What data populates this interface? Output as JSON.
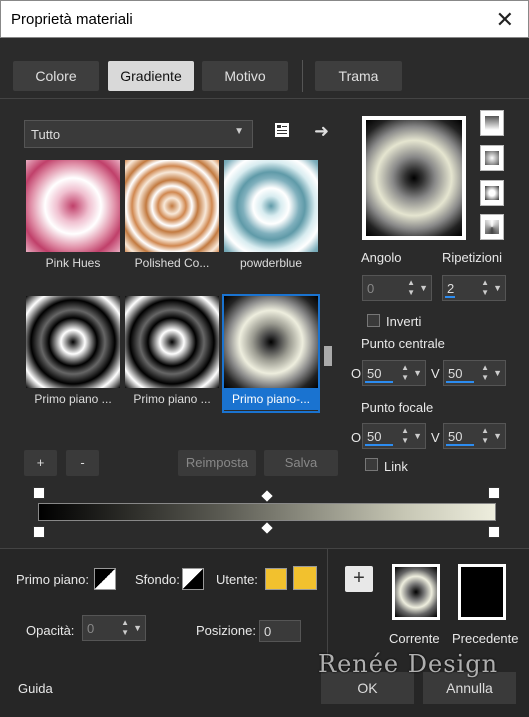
{
  "window": {
    "title": "Proprietà materiali"
  },
  "tabs": [
    {
      "label": "Colore",
      "active": false
    },
    {
      "label": "Gradiente",
      "active": true
    },
    {
      "label": "Motivo",
      "active": false
    },
    {
      "label": "Trama",
      "active": false
    }
  ],
  "category": {
    "value": "Tutto"
  },
  "swatches": [
    {
      "label": "Pink Hues"
    },
    {
      "label": "Polished Co..."
    },
    {
      "label": "powderblue"
    },
    {
      "label": "Primo piano ..."
    },
    {
      "label": "Primo piano ..."
    },
    {
      "label": "Primo piano-..."
    }
  ],
  "buttons": {
    "add": "+",
    "remove": "-",
    "reset": "Reimposta",
    "save": "Salva"
  },
  "angle": {
    "label": "Angolo",
    "value": "0"
  },
  "repeats": {
    "label": "Ripetizioni",
    "value": "2"
  },
  "invert": {
    "label": "Inverti",
    "checked": false
  },
  "center": {
    "label": "Punto centrale",
    "o_label": "O",
    "o_value": "50",
    "v_label": "V",
    "v_value": "50"
  },
  "focal": {
    "label": "Punto focale",
    "o_label": "O",
    "o_value": "50",
    "v_label": "V",
    "v_value": "50"
  },
  "link": {
    "label": "Link",
    "checked": false
  },
  "foreground": {
    "label": "Primo piano:"
  },
  "background": {
    "label": "Sfondo:"
  },
  "user": {
    "label": "Utente:",
    "color": "#f2c12e"
  },
  "opacity": {
    "label": "Opacità:",
    "value": "0"
  },
  "position": {
    "label": "Posizione:",
    "value": "0"
  },
  "preview": {
    "current_label": "Corrente",
    "previous_label": "Precedente"
  },
  "footer": {
    "help": "Guida",
    "ok": "OK",
    "cancel": "Annulla"
  },
  "watermark": {
    "text": "Renée Design"
  },
  "colors": {
    "accent": "#1a73d0",
    "panel": "#2b2b2b",
    "user_swatch": "#f2c12e"
  }
}
